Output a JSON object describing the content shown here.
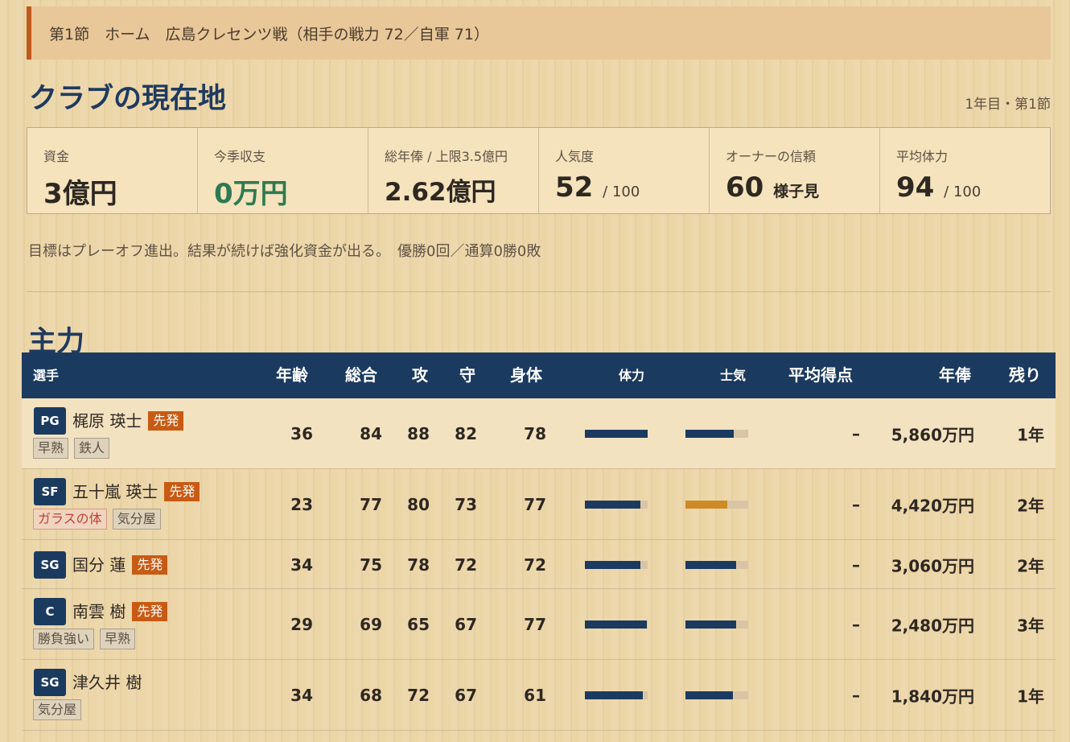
{
  "banner": "第1節　ホーム　広島クレセンツ戦（相手の戦力 72／自軍 71）",
  "club": {
    "title": "クラブの現在地",
    "season": "1年目・第1節",
    "stats": [
      {
        "label": "資金",
        "value": "3億円"
      },
      {
        "label": "今季収支",
        "value": "0万円",
        "color": "#2e7a52"
      },
      {
        "label": "総年俸 / 上限3.5億円",
        "value": "2.62億円"
      },
      {
        "label": "人気度",
        "value": "52",
        "unit": "/ 100"
      },
      {
        "label": "オーナーの信頼",
        "value": "60",
        "suffix": "様子見"
      },
      {
        "label": "平均体力",
        "value": "94",
        "unit": "/ 100"
      }
    ],
    "goal": "目標はプレーオフ進出。結果が続けば強化資金が出る。　優勝0回／通算0勝0敗"
  },
  "roster": {
    "title": "主力",
    "headers": {
      "player": "選手",
      "age": "年齢",
      "overall": "総合",
      "off": "攻",
      "def": "守",
      "phys": "身体",
      "stamina": "体力",
      "morale": "士気",
      "avg_pts": "平均得点",
      "salary": "年俸",
      "years": "残り"
    },
    "players": [
      {
        "pos": "PG",
        "name": "梶原 瑛士",
        "starter": "先発",
        "tags": [
          {
            "text": "早熟",
            "warn": false
          },
          {
            "text": "鉄人",
            "warn": false
          }
        ],
        "age": "36",
        "overall": "84",
        "off": "88",
        "def": "82",
        "phys": "78",
        "stamina": 1.0,
        "morale": 0.77,
        "morale_color": "#1b3a60",
        "avg_pts": "–",
        "salary": "5,860万円",
        "years": "1年"
      },
      {
        "pos": "SF",
        "name": "五十嵐 瑛士",
        "starter": "先発",
        "tags": [
          {
            "text": "ガラスの体",
            "warn": true
          },
          {
            "text": "気分屋",
            "warn": false
          }
        ],
        "age": "23",
        "overall": "77",
        "off": "80",
        "def": "73",
        "phys": "77",
        "stamina": 0.89,
        "morale": 0.67,
        "morale_color": "#cd8a25",
        "avg_pts": "–",
        "salary": "4,420万円",
        "years": "2年"
      },
      {
        "pos": "SG",
        "name": "国分 蓮",
        "starter": "先発",
        "tags": [],
        "age": "34",
        "overall": "75",
        "off": "78",
        "def": "72",
        "phys": "72",
        "stamina": 0.88,
        "morale": 0.81,
        "morale_color": "#1b3a60",
        "avg_pts": "–",
        "salary": "3,060万円",
        "years": "2年"
      },
      {
        "pos": "C",
        "name": "南雲 樹",
        "starter": "先発",
        "tags": [
          {
            "text": "勝負強い",
            "warn": false
          },
          {
            "text": "早熟",
            "warn": false
          }
        ],
        "age": "29",
        "overall": "69",
        "off": "65",
        "def": "67",
        "phys": "77",
        "stamina": 0.99,
        "morale": 0.81,
        "morale_color": "#1b3a60",
        "avg_pts": "–",
        "salary": "2,480万円",
        "years": "3年"
      },
      {
        "pos": "SG",
        "name": "津久井 樹",
        "starter": "",
        "tags": [
          {
            "text": "気分屋",
            "warn": false
          }
        ],
        "age": "34",
        "overall": "68",
        "off": "72",
        "def": "67",
        "phys": "61",
        "stamina": 0.92,
        "morale": 0.76,
        "morale_color": "#1b3a60",
        "avg_pts": "–",
        "salary": "1,840万円",
        "years": "1年"
      }
    ]
  }
}
